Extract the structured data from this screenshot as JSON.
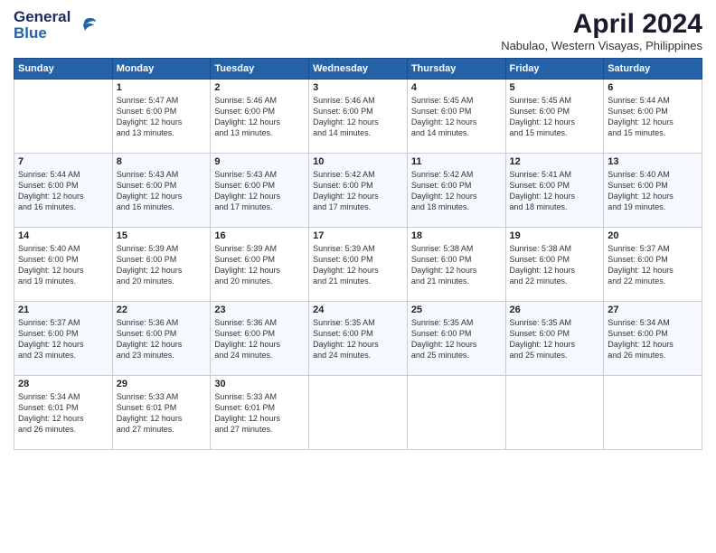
{
  "logo": {
    "line1": "General",
    "line2": "Blue"
  },
  "title": "April 2024",
  "location": "Nabulao, Western Visayas, Philippines",
  "days_header": [
    "Sunday",
    "Monday",
    "Tuesday",
    "Wednesday",
    "Thursday",
    "Friday",
    "Saturday"
  ],
  "weeks": [
    [
      {
        "num": "",
        "text": ""
      },
      {
        "num": "1",
        "text": "Sunrise: 5:47 AM\nSunset: 6:00 PM\nDaylight: 12 hours\nand 13 minutes."
      },
      {
        "num": "2",
        "text": "Sunrise: 5:46 AM\nSunset: 6:00 PM\nDaylight: 12 hours\nand 13 minutes."
      },
      {
        "num": "3",
        "text": "Sunrise: 5:46 AM\nSunset: 6:00 PM\nDaylight: 12 hours\nand 14 minutes."
      },
      {
        "num": "4",
        "text": "Sunrise: 5:45 AM\nSunset: 6:00 PM\nDaylight: 12 hours\nand 14 minutes."
      },
      {
        "num": "5",
        "text": "Sunrise: 5:45 AM\nSunset: 6:00 PM\nDaylight: 12 hours\nand 15 minutes."
      },
      {
        "num": "6",
        "text": "Sunrise: 5:44 AM\nSunset: 6:00 PM\nDaylight: 12 hours\nand 15 minutes."
      }
    ],
    [
      {
        "num": "7",
        "text": "Sunrise: 5:44 AM\nSunset: 6:00 PM\nDaylight: 12 hours\nand 16 minutes."
      },
      {
        "num": "8",
        "text": "Sunrise: 5:43 AM\nSunset: 6:00 PM\nDaylight: 12 hours\nand 16 minutes."
      },
      {
        "num": "9",
        "text": "Sunrise: 5:43 AM\nSunset: 6:00 PM\nDaylight: 12 hours\nand 17 minutes."
      },
      {
        "num": "10",
        "text": "Sunrise: 5:42 AM\nSunset: 6:00 PM\nDaylight: 12 hours\nand 17 minutes."
      },
      {
        "num": "11",
        "text": "Sunrise: 5:42 AM\nSunset: 6:00 PM\nDaylight: 12 hours\nand 18 minutes."
      },
      {
        "num": "12",
        "text": "Sunrise: 5:41 AM\nSunset: 6:00 PM\nDaylight: 12 hours\nand 18 minutes."
      },
      {
        "num": "13",
        "text": "Sunrise: 5:40 AM\nSunset: 6:00 PM\nDaylight: 12 hours\nand 19 minutes."
      }
    ],
    [
      {
        "num": "14",
        "text": "Sunrise: 5:40 AM\nSunset: 6:00 PM\nDaylight: 12 hours\nand 19 minutes."
      },
      {
        "num": "15",
        "text": "Sunrise: 5:39 AM\nSunset: 6:00 PM\nDaylight: 12 hours\nand 20 minutes."
      },
      {
        "num": "16",
        "text": "Sunrise: 5:39 AM\nSunset: 6:00 PM\nDaylight: 12 hours\nand 20 minutes."
      },
      {
        "num": "17",
        "text": "Sunrise: 5:39 AM\nSunset: 6:00 PM\nDaylight: 12 hours\nand 21 minutes."
      },
      {
        "num": "18",
        "text": "Sunrise: 5:38 AM\nSunset: 6:00 PM\nDaylight: 12 hours\nand 21 minutes."
      },
      {
        "num": "19",
        "text": "Sunrise: 5:38 AM\nSunset: 6:00 PM\nDaylight: 12 hours\nand 22 minutes."
      },
      {
        "num": "20",
        "text": "Sunrise: 5:37 AM\nSunset: 6:00 PM\nDaylight: 12 hours\nand 22 minutes."
      }
    ],
    [
      {
        "num": "21",
        "text": "Sunrise: 5:37 AM\nSunset: 6:00 PM\nDaylight: 12 hours\nand 23 minutes."
      },
      {
        "num": "22",
        "text": "Sunrise: 5:36 AM\nSunset: 6:00 PM\nDaylight: 12 hours\nand 23 minutes."
      },
      {
        "num": "23",
        "text": "Sunrise: 5:36 AM\nSunset: 6:00 PM\nDaylight: 12 hours\nand 24 minutes."
      },
      {
        "num": "24",
        "text": "Sunrise: 5:35 AM\nSunset: 6:00 PM\nDaylight: 12 hours\nand 24 minutes."
      },
      {
        "num": "25",
        "text": "Sunrise: 5:35 AM\nSunset: 6:00 PM\nDaylight: 12 hours\nand 25 minutes."
      },
      {
        "num": "26",
        "text": "Sunrise: 5:35 AM\nSunset: 6:00 PM\nDaylight: 12 hours\nand 25 minutes."
      },
      {
        "num": "27",
        "text": "Sunrise: 5:34 AM\nSunset: 6:00 PM\nDaylight: 12 hours\nand 26 minutes."
      }
    ],
    [
      {
        "num": "28",
        "text": "Sunrise: 5:34 AM\nSunset: 6:01 PM\nDaylight: 12 hours\nand 26 minutes."
      },
      {
        "num": "29",
        "text": "Sunrise: 5:33 AM\nSunset: 6:01 PM\nDaylight: 12 hours\nand 27 minutes."
      },
      {
        "num": "30",
        "text": "Sunrise: 5:33 AM\nSunset: 6:01 PM\nDaylight: 12 hours\nand 27 minutes."
      },
      {
        "num": "",
        "text": ""
      },
      {
        "num": "",
        "text": ""
      },
      {
        "num": "",
        "text": ""
      },
      {
        "num": "",
        "text": ""
      }
    ]
  ]
}
